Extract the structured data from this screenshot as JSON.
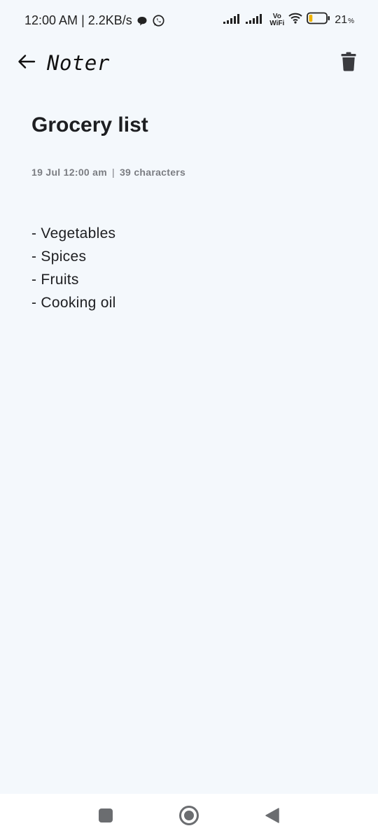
{
  "status_bar": {
    "time": "12:00 AM",
    "network_speed": "2.2KB/s",
    "separator": "|",
    "notification_icons": [
      "chat-bubble-icon",
      "whatsapp-icon"
    ],
    "signal_icons": [
      "signal-bars-icon",
      "signal-bars-icon"
    ],
    "vowifi_top": "Vo",
    "vowifi_bottom": "WiFi",
    "battery_level": "21",
    "battery_unit": "%",
    "battery_fill_fraction": 0.21,
    "battery_color": "#f0b400"
  },
  "app_bar": {
    "back_icon": "arrow-left-icon",
    "title": "Noter",
    "delete_icon": "trash-icon"
  },
  "note": {
    "title": "Grocery list",
    "date": "19 Jul 12:00 am",
    "separator": "|",
    "char_count": "39 characters",
    "lines": [
      "- Vegetables",
      "- Spices",
      "- Fruits",
      "- Cooking oil"
    ]
  },
  "nav_bar": {
    "recents_icon": "square-icon",
    "home_icon": "circle-icon",
    "back_icon": "triangle-back-icon"
  },
  "colors": {
    "background": "#f4f8fc",
    "text_primary": "#1d1e21",
    "text_secondary": "#7b7d82",
    "nav_background": "#ffffff"
  }
}
